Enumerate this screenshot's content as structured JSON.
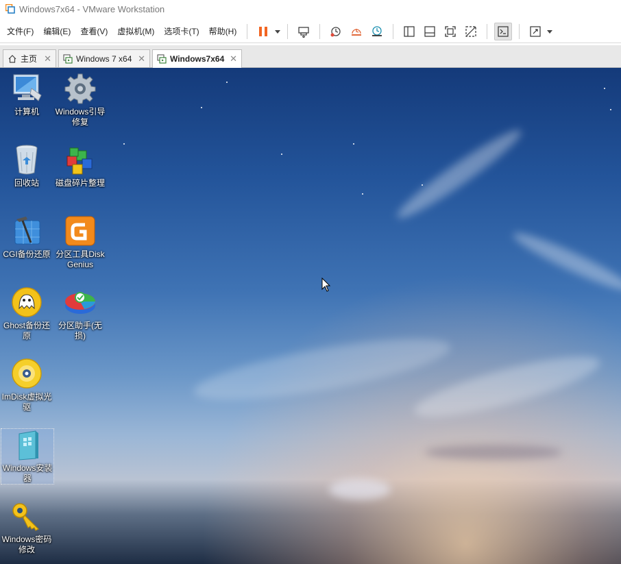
{
  "window": {
    "title": "Windows7x64 - VMware Workstation"
  },
  "menubar": {
    "items": [
      "文件(F)",
      "编辑(E)",
      "查看(V)",
      "虚拟机(M)",
      "选项卡(T)",
      "帮助(H)"
    ]
  },
  "toolbar": {
    "buttons": [
      "pause-icon",
      "send-ctrl-alt-del-icon",
      "snapshot-icon",
      "revert-snapshot-icon",
      "snapshot-manager-icon",
      "show-library-icon",
      "thumbnail-bar-icon",
      "full-screen-icon",
      "unity-icon",
      "console-view-icon",
      "stretch-icon"
    ]
  },
  "tabs": [
    {
      "label": "主页",
      "icon": "home-icon"
    },
    {
      "label": "Windows 7 x64",
      "icon": "vm-icon"
    },
    {
      "label": "Windows7x64",
      "icon": "vm-icon",
      "active": true
    }
  ],
  "desktop": {
    "icons": [
      {
        "label": "计算机",
        "icon": "computer-icon"
      },
      {
        "label": "Windows引导修复",
        "icon": "gear-icon"
      },
      {
        "label": "回收站",
        "icon": "recycle-bin-icon"
      },
      {
        "label": "磁盘碎片整理",
        "icon": "defrag-icon"
      },
      {
        "label": "CGI备份还原",
        "icon": "cgi-backup-icon"
      },
      {
        "label": "分区工具DiskGenius",
        "icon": "diskgenius-icon"
      },
      {
        "label": "Ghost备份还原",
        "icon": "ghost-icon"
      },
      {
        "label": "分区助手(无损)",
        "icon": "partition-assistant-icon"
      },
      {
        "label": "ImDisk虚拟光驱",
        "icon": "imdisk-icon"
      },
      {
        "label": "Windows安装器",
        "icon": "windows-installer-icon"
      },
      {
        "label": "Windows密码修改",
        "icon": "key-icon"
      }
    ]
  },
  "colors": {
    "pause": "#f26522",
    "tab_active_bg": "#ffffff",
    "desktop_top": "#143a7a"
  }
}
